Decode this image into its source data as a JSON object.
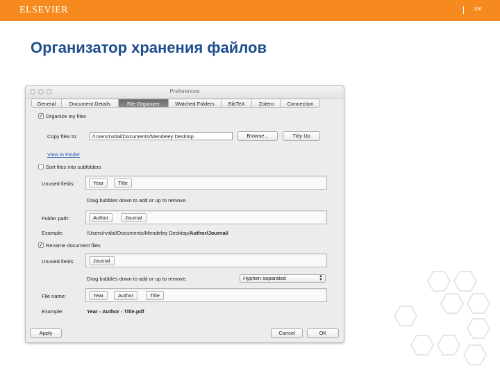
{
  "slide": {
    "brand": "ELSEVIER",
    "page_number": "106",
    "title": "Организатор хранения файлов"
  },
  "window": {
    "title": "Preferences",
    "tabs": [
      {
        "label": "General",
        "active": false
      },
      {
        "label": "Document Details",
        "active": false
      },
      {
        "label": "File Organizer",
        "active": true
      },
      {
        "label": "Watched Folders",
        "active": false
      },
      {
        "label": "BibTeX",
        "active": false
      },
      {
        "label": "Zotero",
        "active": false
      },
      {
        "label": "Connection",
        "active": false
      }
    ],
    "organize": {
      "label": "Organize my files",
      "checked": true,
      "copy_label": "Copy files to:",
      "path_value": "/Users/rvidal/Documents/Mendeley Desktop",
      "browse_label": "Browse...",
      "tidy_label": "Tidy Up",
      "view_link": "View in Finder"
    },
    "subfolders": {
      "label": "Sort files into subfolders",
      "checked": false,
      "unused_label": "Unused fields:",
      "unused_bubbles": [
        "Year",
        "Title"
      ],
      "hint": "Drag bubbles down to add or up to remove.",
      "folder_path_label": "Folder path:",
      "folder_bubbles": [
        "Author",
        "Journal"
      ],
      "example_label": "Example:",
      "example_prefix": "/Users/rvidal/Documents/Mendeley Desktop/",
      "example_bold": "Author/Journal/"
    },
    "rename": {
      "label": "Rename document files",
      "checked": true,
      "unused_label": "Unused fields:",
      "unused_bubbles": [
        "Journal"
      ],
      "hint": "Drag bubbles down to add or up to remove.",
      "separator_value": "Hyphen-separated",
      "filename_label": "File name:",
      "filename_bubbles": [
        "Year",
        "Author",
        "Title"
      ],
      "example_label": "Example:",
      "example_value": "Year - Author - Title.pdf"
    },
    "footer": {
      "apply_label": "Apply",
      "cancel_label": "Cancel",
      "ok_label": "OK"
    }
  },
  "colors": {
    "brand_orange": "#f68a1e",
    "title_blue": "#1f4e8c",
    "link_blue": "#2a54b8"
  }
}
